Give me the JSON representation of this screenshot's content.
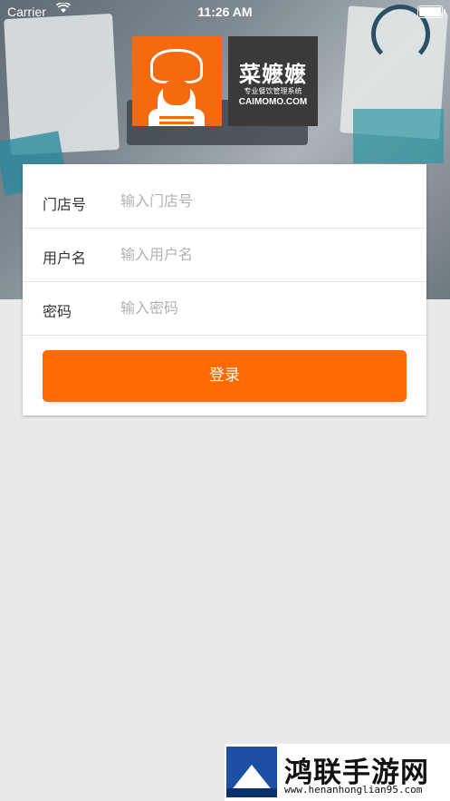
{
  "status_bar": {
    "carrier": "Carrier",
    "wifi_icon": "wifi-icon",
    "time": "11:26 AM",
    "battery_icon": "battery-icon"
  },
  "brand": {
    "name": "菜嬷嬷",
    "subtitle": "专业餐饮管理系统",
    "domain": "CAIMOMO.COM",
    "logo_color": "#f56a0f",
    "brand_box_color": "#3a3a3a"
  },
  "form": {
    "store": {
      "label": "门店号",
      "placeholder": "输入门店号",
      "value": ""
    },
    "username": {
      "label": "用户名",
      "placeholder": "输入用户名",
      "value": ""
    },
    "password": {
      "label": "密码",
      "placeholder": "输入密码",
      "value": ""
    },
    "login_label": "登录",
    "accent_color": "#ff6a05"
  },
  "watermark": {
    "title": "鸿联手游网",
    "url": "www.henanhonglian95.com"
  }
}
